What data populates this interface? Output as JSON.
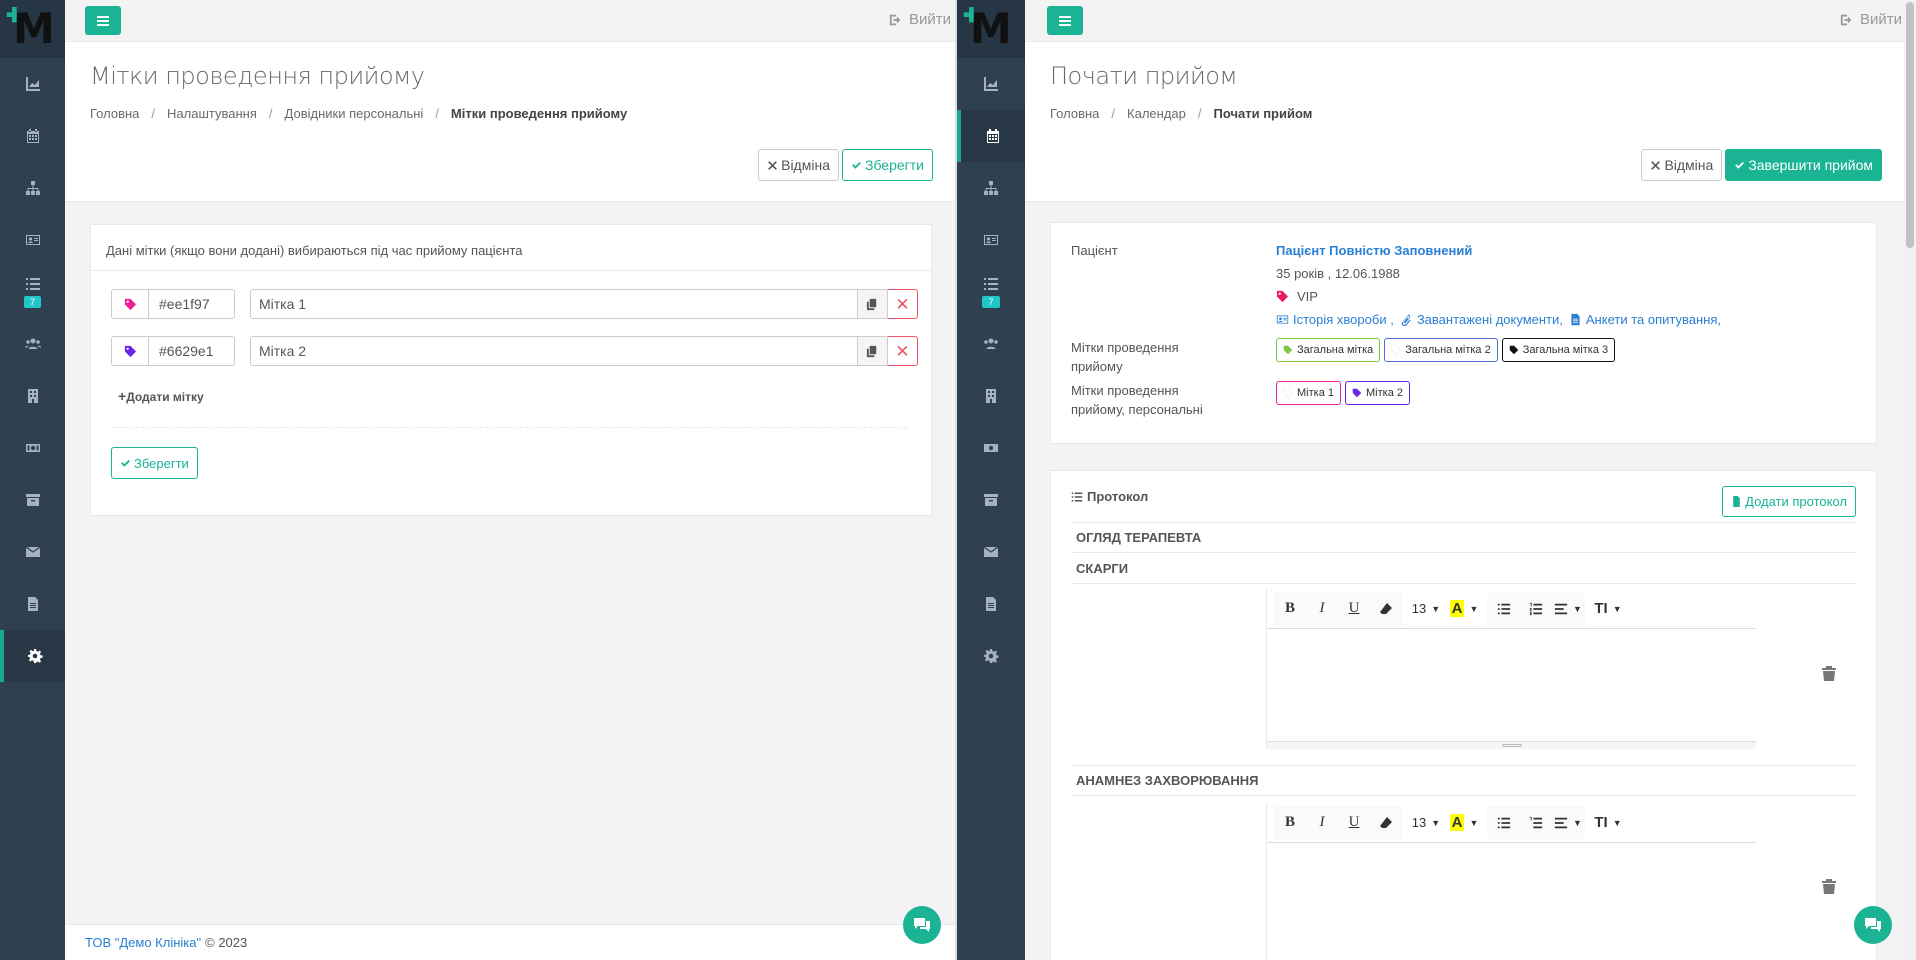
{
  "left": {
    "nav_badge": "7",
    "logout_label": "Вийти",
    "page_title": "Мітки проведення прийому",
    "breadcrumb": [
      "Головна",
      "Налаштування",
      "Довідники персональні",
      "Мітки проведення прийому"
    ],
    "cancel_label": "Відміна",
    "save_label": "Зберегти",
    "card_heading": "Дані мітки (якщо вони додані) вибираються під час прийому пацієнта",
    "tags": [
      {
        "color": "#ee1f97",
        "name": "Мітка 1"
      },
      {
        "color": "#6629e1",
        "name": "Мітка 2"
      }
    ],
    "add_tag_label": "Додати мітку",
    "form_save_label": "Зберегти",
    "footer_company": "ТОВ \"Демо Клініка\"",
    "footer_copy": "© 2023"
  },
  "right": {
    "nav_badge": "7",
    "logout_label": "Вийти",
    "page_title": "Почати прийом",
    "breadcrumb": [
      "Головна",
      "Календар",
      "Почати прийом"
    ],
    "cancel_label": "Відміна",
    "finish_label": "Завершити прийом",
    "patient": {
      "label": "Пацієнт",
      "name": "Пацієнт Повністю Заповнений",
      "age_dob": "35 років , 12.06.1988",
      "vip": "VIP",
      "links": [
        "Історія хвороби ,",
        "Завантажені документи,",
        "Анкети та опитування,"
      ]
    },
    "tags_label": "Мітки проведення прийому",
    "tags": [
      {
        "name": "Загальна мітка",
        "color": "#7ac943"
      },
      {
        "name": "Загальна мітка 2",
        "color": "#4a6fdc"
      },
      {
        "name": "Загальна мітка 3",
        "color": "#111111"
      }
    ],
    "personal_tags_label": "Мітки проведення прийому, персональні",
    "personal_tags": [
      {
        "name": "Мітка 1",
        "color": "#ee1f97"
      },
      {
        "name": "Мітка 2",
        "color": "#6629e1"
      }
    ],
    "protocol": {
      "title": "Протокол",
      "add_label": "Додати протокол",
      "section_exam": "ОГЛЯД ТЕРАПЕВТА",
      "section_complaints": "СКАРГИ",
      "section_anamnesis": "АНАМНЕЗ ЗАХВОРЮВАННЯ",
      "font_size": "13"
    }
  },
  "colors": {
    "accent": "#1ab394",
    "sidebar": "#2f4050",
    "danger": "#ed5565",
    "link": "#2a7fd4"
  }
}
